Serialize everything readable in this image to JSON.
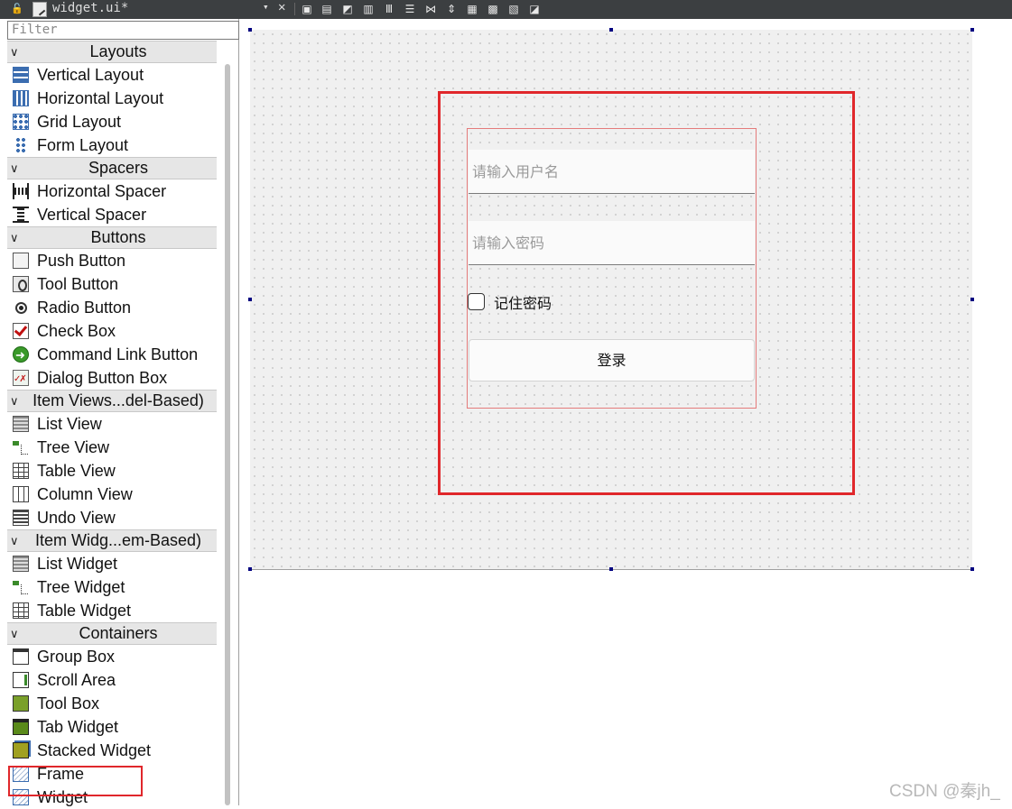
{
  "tab": {
    "title": "widget.ui*",
    "dropdown": "▾",
    "close": "✕"
  },
  "toolbar_icons": [
    "edit-widgets-icon",
    "edit-signals-icon",
    "edit-buddies-icon",
    "edit-tab-order-icon",
    "layout-horizontal-icon",
    "layout-vertical-icon",
    "layout-h-splitter-icon",
    "layout-v-splitter-icon",
    "layout-grid-icon",
    "layout-form-icon",
    "break-layout-icon",
    "adjust-size-icon"
  ],
  "filter": {
    "placeholder": "Filter"
  },
  "sections": [
    {
      "label": "Layouts",
      "items": [
        {
          "label": "Vertical Layout",
          "icon": "vertical-layout-icon"
        },
        {
          "label": "Horizontal Layout",
          "icon": "horizontal-layout-icon"
        },
        {
          "label": "Grid Layout",
          "icon": "grid-layout-icon"
        },
        {
          "label": "Form Layout",
          "icon": "form-layout-icon"
        }
      ]
    },
    {
      "label": "Spacers",
      "items": [
        {
          "label": "Horizontal Spacer",
          "icon": "horizontal-spacer-icon"
        },
        {
          "label": "Vertical Spacer",
          "icon": "vertical-spacer-icon"
        }
      ]
    },
    {
      "label": "Buttons",
      "items": [
        {
          "label": "Push Button",
          "icon": "push-button-icon"
        },
        {
          "label": "Tool Button",
          "icon": "tool-button-icon"
        },
        {
          "label": "Radio Button",
          "icon": "radio-button-icon"
        },
        {
          "label": "Check Box",
          "icon": "check-box-icon"
        },
        {
          "label": "Command Link Button",
          "icon": "command-link-icon"
        },
        {
          "label": "Dialog Button Box",
          "icon": "dialog-button-box-icon"
        }
      ]
    },
    {
      "label": "Item Views...del-Based)",
      "items": [
        {
          "label": "List View",
          "icon": "list-view-icon"
        },
        {
          "label": "Tree View",
          "icon": "tree-view-icon"
        },
        {
          "label": "Table View",
          "icon": "table-view-icon"
        },
        {
          "label": "Column View",
          "icon": "column-view-icon"
        },
        {
          "label": "Undo View",
          "icon": "undo-view-icon"
        }
      ]
    },
    {
      "label": "Item Widg...em-Based)",
      "items": [
        {
          "label": "List Widget",
          "icon": "list-widget-icon"
        },
        {
          "label": "Tree Widget",
          "icon": "tree-widget-icon"
        },
        {
          "label": "Table Widget",
          "icon": "table-widget-icon"
        }
      ]
    },
    {
      "label": "Containers",
      "items": [
        {
          "label": "Group Box",
          "icon": "group-box-icon"
        },
        {
          "label": "Scroll Area",
          "icon": "scroll-area-icon"
        },
        {
          "label": "Tool Box",
          "icon": "tool-box-icon"
        },
        {
          "label": "Tab Widget",
          "icon": "tab-widget-icon"
        },
        {
          "label": "Stacked Widget",
          "icon": "stacked-widget-icon"
        },
        {
          "label": "Frame",
          "icon": "frame-icon"
        },
        {
          "label": "Widget",
          "icon": "widget-icon"
        }
      ]
    }
  ],
  "form": {
    "username_placeholder": "请输入用户名",
    "password_placeholder": "请输入密码",
    "remember_label": "记住密码",
    "remember_checked": false,
    "login_label": "登录"
  },
  "watermark": "CSDN @秦jh_"
}
